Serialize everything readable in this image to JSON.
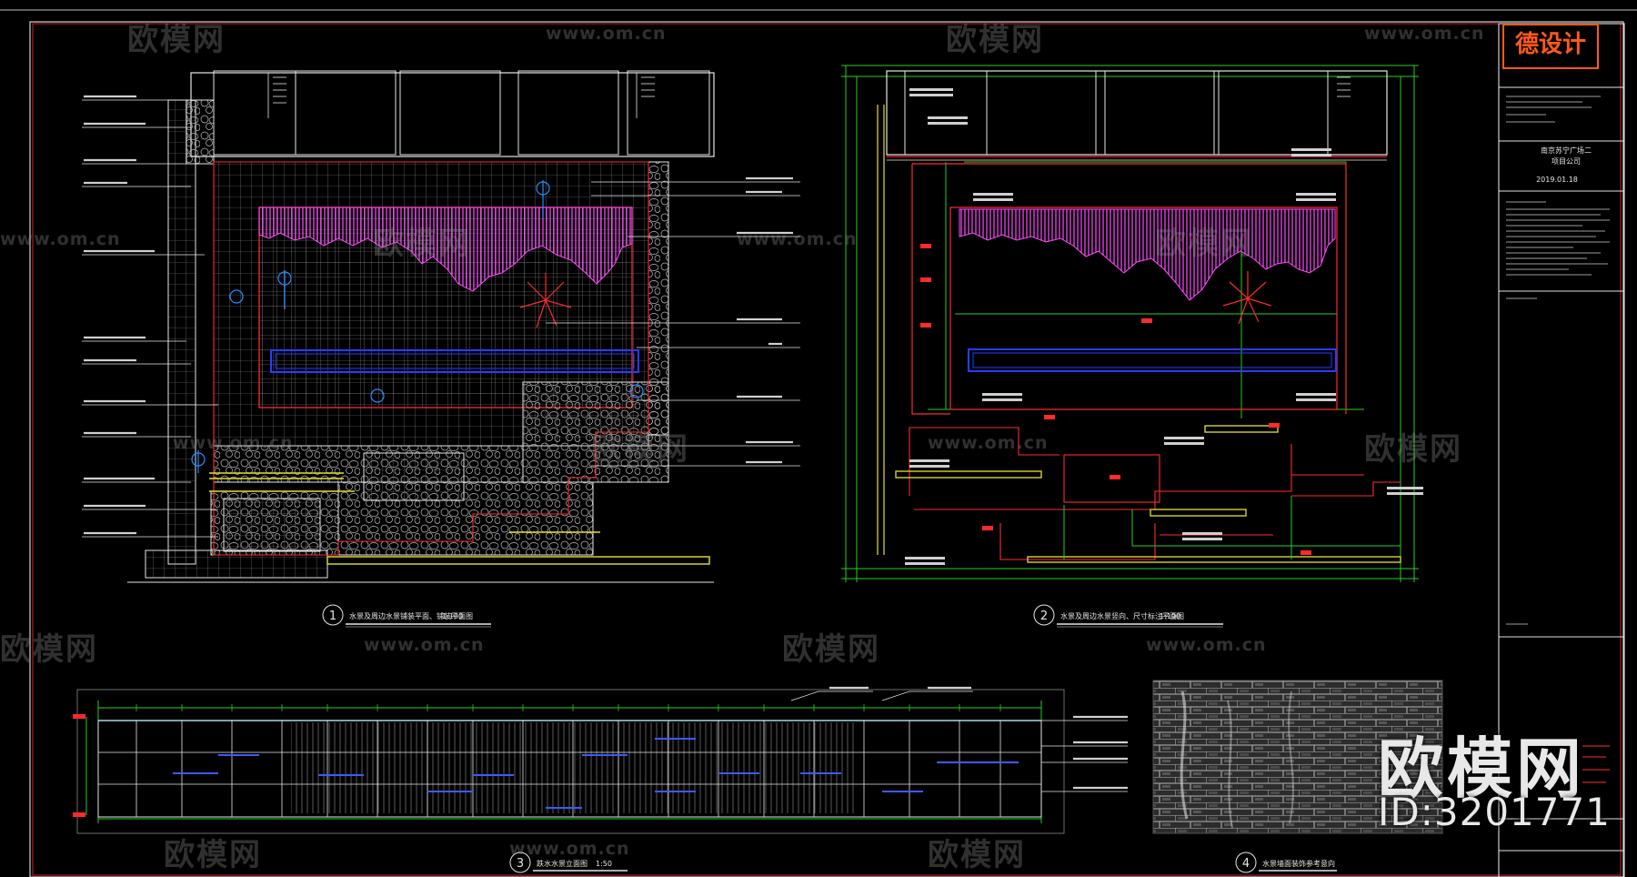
{
  "watermark": {
    "brand": "欧模网",
    "url": "www.om.cn",
    "id_label": "ID:3201771"
  },
  "title_block": {
    "logo_text": "德设计",
    "project_label_1": "南京苏宁广场二",
    "project_label_2": "项目公司",
    "date": "2019.01.18"
  },
  "drawings": [
    {
      "number": "1",
      "title": "水景及周边水景铺装平面、铺装平面图",
      "scale": "1:100"
    },
    {
      "number": "2",
      "title": "水景及周边水景竖向、尺寸标注平面图",
      "scale": "1:100"
    },
    {
      "number": "3",
      "title": "跌水水景立面图",
      "scale": "1:50"
    },
    {
      "number": "4",
      "title": "水景墙面装饰参考意向",
      "scale": ""
    }
  ],
  "colors": {
    "background": "#000000",
    "line_white": "#e6e6e6",
    "line_green": "#22d122",
    "line_red": "#ff2a2a",
    "fill_magenta": "#d018d0",
    "line_blue": "#2a3cff",
    "line_yellow": "#e8e030",
    "line_cyan": "#20c8d8",
    "accent_orange": "#ff5a1a"
  }
}
